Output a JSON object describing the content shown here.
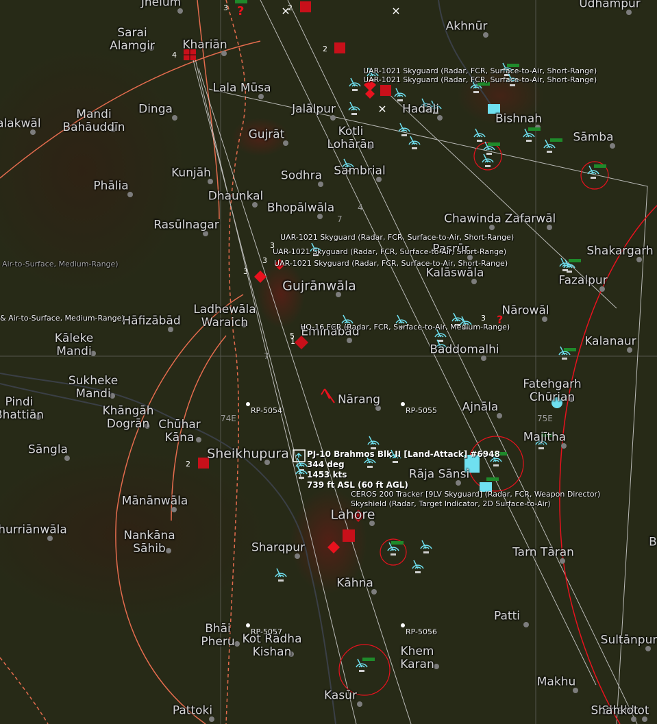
{
  "map": {
    "towns": [
      {
        "name": "Jhelum"
      },
      {
        "name": "Udhampur"
      },
      {
        "name": "Sarai\nAlamgir"
      },
      {
        "name": "Khariān"
      },
      {
        "name": "Akhnūr"
      },
      {
        "name": "Lala Mūsa"
      },
      {
        "name": "Jalālpur"
      },
      {
        "name": "Hadāli"
      },
      {
        "name": "Bishnah"
      },
      {
        "name": "Sāmba"
      },
      {
        "name": "Mandi\nBahāuddīn"
      },
      {
        "name": "Dinga"
      },
      {
        "name": "Malakwāl"
      },
      {
        "name": "Gujrāt"
      },
      {
        "name": "Kotli\nLohārān"
      },
      {
        "name": "Sambrial"
      },
      {
        "name": "Kunjāh"
      },
      {
        "name": "Sodhra"
      },
      {
        "name": "Phālia"
      },
      {
        "name": "Dhaunkal"
      },
      {
        "name": "Bhopālwāla"
      },
      {
        "name": "Chawinda"
      },
      {
        "name": "Zafarwāl"
      },
      {
        "name": "Rasūlnagar"
      },
      {
        "name": "Shakargarh"
      },
      {
        "name": "Pasrūr"
      },
      {
        "name": "Kalāswāla"
      },
      {
        "name": "Fazalpur"
      },
      {
        "name": "Gujrānwāla"
      },
      {
        "name": "Ladhewāla\nWaraich"
      },
      {
        "name": "Nārowāl"
      },
      {
        "name": "Hāfizābād"
      },
      {
        "name": "Eminābād"
      },
      {
        "name": "Kalanaur"
      },
      {
        "name": "Kāleke\nMandi"
      },
      {
        "name": "Baddomalhi"
      },
      {
        "name": "Sukheke\nMandi"
      },
      {
        "name": "Fatehgarh\nChūrian"
      },
      {
        "name": "Pindi\nBhattiān"
      },
      {
        "name": "Khāngāh\nDogrān"
      },
      {
        "name": "Nārang"
      },
      {
        "name": "Ajnāla"
      },
      {
        "name": "Chūhar\nKāna"
      },
      {
        "name": "Sāngla"
      },
      {
        "name": "Sheikhupura"
      },
      {
        "name": "Majītha"
      },
      {
        "name": "Rāja Sānsi"
      },
      {
        "name": "Mānānwāla"
      },
      {
        "name": "Lahore"
      },
      {
        "name": "Nankāna\nSāhib"
      },
      {
        "name": "Shahkot"
      },
      {
        "name": "Jhurriānwāla"
      },
      {
        "name": "Sharqpur"
      },
      {
        "name": "Tarn Tāran"
      },
      {
        "name": "Kāhna"
      },
      {
        "name": "Patti"
      },
      {
        "name": "Bhāi\nPheru"
      },
      {
        "name": "Kot Rādha\nKishan"
      },
      {
        "name": "Sultānpur"
      },
      {
        "name": "Khem\nKaran"
      },
      {
        "name": "Makhu"
      },
      {
        "name": "Kasūr"
      },
      {
        "name": "Pattoki"
      },
      {
        "name": "Shahkot"
      },
      {
        "name": "B"
      }
    ],
    "unit_labels": [
      {
        "text": "UAR-1021 Skyguard (Radar, FCR, Surface-to-Air, Short-Range)"
      },
      {
        "text": "UAR-1021 Skyguard (Radar, FCR, Surface-to-Air, Short-Range)"
      },
      {
        "text": "UAR-1021 Skyguard (Radar, FCR, Surface-to-Air, Short-Range)"
      },
      {
        "text": "UAR-1021 Skyguard (Radar, FCR, Surface-to-Air, Short-Range)"
      },
      {
        "text": "UAR-1021 Skyguard (Radar, FCR, Surface-to-Air, Short-Range)"
      },
      {
        "text": "HQ-16 FCR (Radar, FCR, Surface-to-Air, Medium-Range)"
      },
      {
        "text": "Air-to-Surface, Medium-Range)"
      },
      {
        "text": "& Air-to-Surface, Medium-Range)"
      },
      {
        "text": "CEROS 200 Tracker [9LV Skyguard] (Radar, FCR, Weapon Director)"
      },
      {
        "text": "Skyshield (Radar, Target Indicator, 2D Surface-to-Air)"
      }
    ],
    "selected_track": {
      "name": "PJ-10 Brahmos Blk II [Land-Attack] #6948",
      "heading": "344 deg",
      "speed": "1453 kts",
      "altitude": "739 ft ASL (60 ft AGL)"
    },
    "reference_points": [
      {
        "label": "RP-5054"
      },
      {
        "label": "RP-5055"
      },
      {
        "label": "RP-5057"
      },
      {
        "label": "RP-5056"
      }
    ],
    "grid_labels": [
      {
        "label": "74E"
      },
      {
        "label": "75E"
      },
      {
        "label": "4"
      },
      {
        "label": "7"
      },
      {
        "label": "7"
      }
    ],
    "counts": [
      "2",
      "3",
      "4",
      "2",
      "3",
      "3",
      "3",
      "5",
      "1",
      "3",
      "2"
    ],
    "colors": {
      "hostile": "#e8121e",
      "friendly_radar": "#6fe0f0",
      "friendly_bar": "#1f8a2b",
      "range_ring": "#e8121e",
      "bright_road": "#e46c4e",
      "track_line": "#d8d8d8"
    }
  }
}
